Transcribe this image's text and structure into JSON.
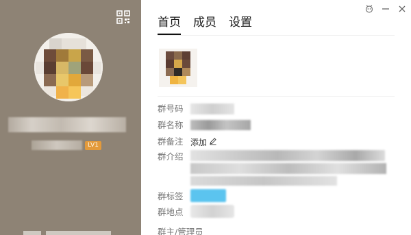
{
  "left": {
    "level_badge": "LV1"
  },
  "tabs": [
    {
      "label": "首页",
      "active": true
    },
    {
      "label": "成员",
      "active": false
    },
    {
      "label": "设置",
      "active": false
    }
  ],
  "info": {
    "group_number_label": "群号码",
    "group_name_label": "群名称",
    "group_remark_label": "群备注",
    "group_remark_action": "添加",
    "group_intro_label": "群介绍",
    "group_tags_label": "群标签",
    "group_location_label": "群地点",
    "group_owner_label": "群主/管理员"
  },
  "colors": {
    "left_bg": "#8e8375",
    "badge_orange": "#e39a3b",
    "tag_blue": "#5bc4ef"
  },
  "icons": {
    "qr": "qr-code-icon",
    "skin": "skin-icon",
    "minimize": "minimize-icon",
    "close": "close-icon",
    "edit": "pencil-icon"
  }
}
